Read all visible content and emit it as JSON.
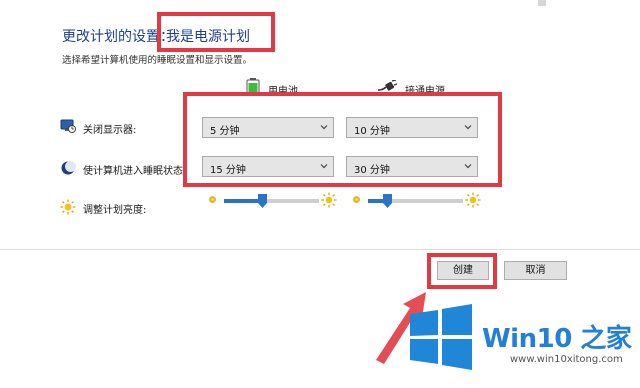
{
  "header": {
    "title_prefix": "更改计划的设置：",
    "plan_name": "我是电源计划",
    "subtitle": "选择希望计算机使用的睡眠设置和显示设置。"
  },
  "columns": {
    "on_battery": "用电池",
    "plugged_in": "接通电源"
  },
  "rows": {
    "turn_off_display": {
      "label": "关闭显示器:",
      "on_battery": "5 分钟",
      "plugged_in": "10 分钟"
    },
    "put_to_sleep": {
      "label": "使计算机进入睡眠状态:",
      "on_battery": "15 分钟",
      "plugged_in": "30 分钟"
    },
    "brightness": {
      "label": "调整计划亮度:",
      "on_battery_level": 0.4,
      "plugged_in_level": 0.2
    }
  },
  "buttons": {
    "create": "创建",
    "cancel": "取消"
  },
  "watermark": {
    "brand": "Win10 之家",
    "url": "www.win10xitong.com"
  },
  "colors": {
    "highlight_red": "#e23a44",
    "title_blue": "#1e3f8f",
    "accent_blue": "#2a74c8",
    "brand_blue": "#2380d6"
  },
  "icons": {
    "battery": "battery-icon",
    "plug": "plug-icon",
    "display": "display-icon",
    "sleep": "moon-icon",
    "brightness": "sun-icon"
  }
}
